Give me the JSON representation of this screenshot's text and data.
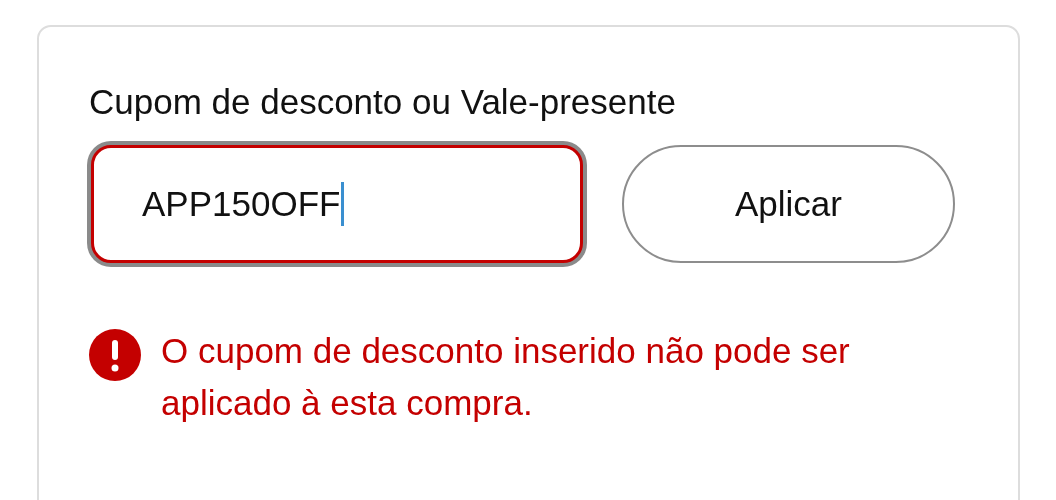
{
  "coupon_section": {
    "label": "Cupom de desconto ou Vale-presente",
    "coupon_input": {
      "value": "APP150OFF",
      "error": true,
      "focused": true
    },
    "apply_button": "Aplicar",
    "error_message": "O cupom de desconto inserido não pode ser aplicado à esta compra."
  }
}
